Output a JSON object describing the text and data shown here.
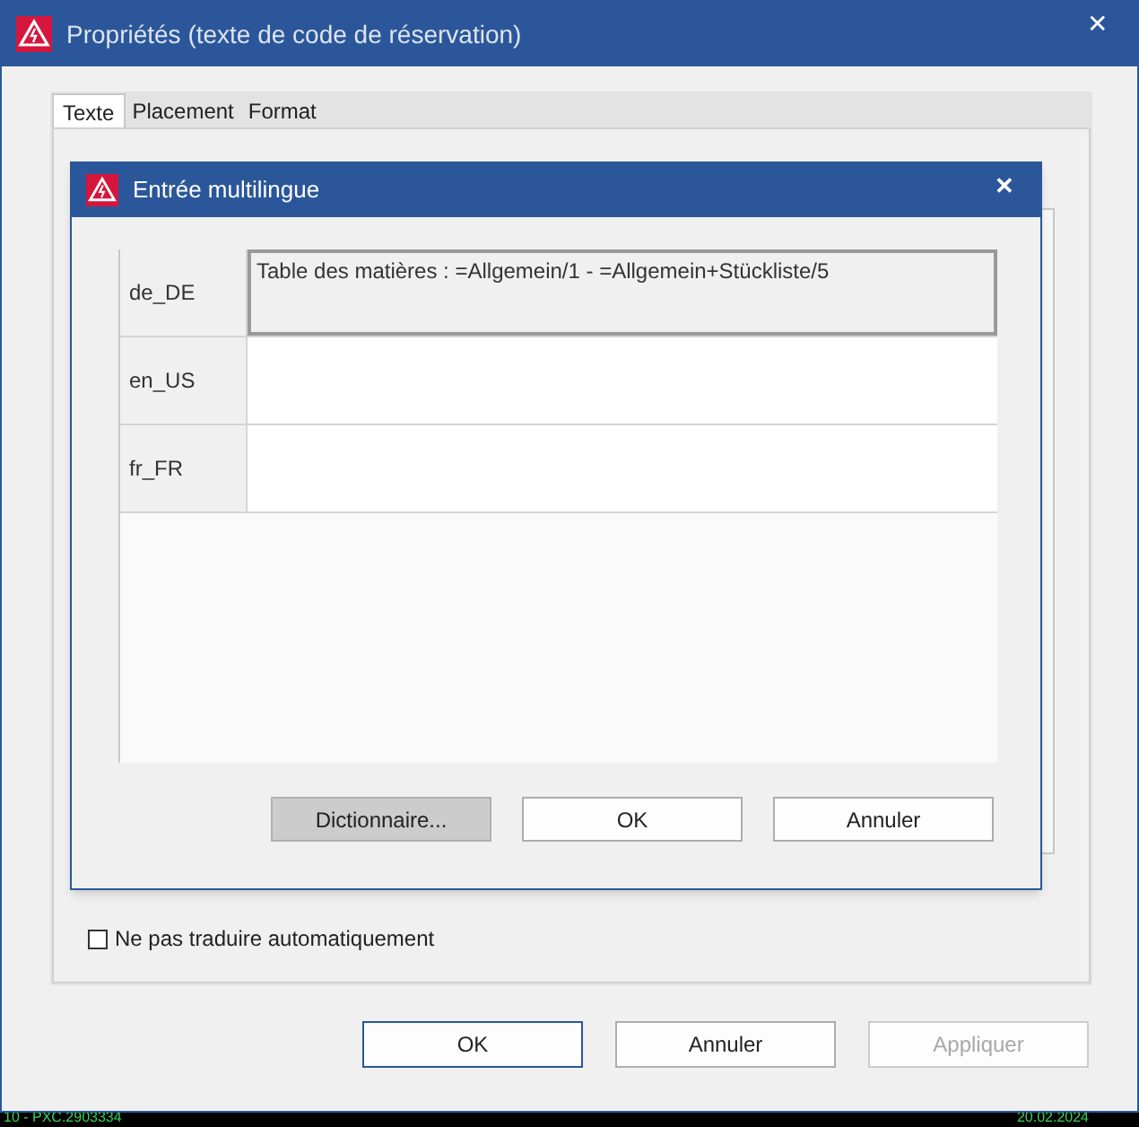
{
  "window": {
    "title": "Propriétés (texte de code de réservation)",
    "close": "✕"
  },
  "tabs": [
    {
      "label": "Texte",
      "selected": true
    },
    {
      "label": "Placement",
      "selected": false
    },
    {
      "label": "Format",
      "selected": false
    }
  ],
  "options": [
    {
      "label": "Ne pas traduire automatiquement",
      "checked": false,
      "disabled": false
    }
  ],
  "buttons": [
    {
      "label": "OK",
      "default": true,
      "disabled": false
    },
    {
      "label": "Annuler",
      "default": false,
      "disabled": false
    },
    {
      "label": "Appliquer",
      "default": false,
      "disabled": true
    }
  ],
  "dialog": {
    "title": "Entrée multilingue",
    "close": "✕",
    "rows": [
      {
        "language": "de_DE",
        "value": "Table des matières : =Allgemein/1 - =Allgemein+Stückliste/5",
        "selected": true
      },
      {
        "language": "en_US",
        "value": "",
        "selected": false
      },
      {
        "language": "fr_FR",
        "value": "",
        "selected": false
      }
    ],
    "buttons": [
      {
        "label": "Dictionnaire...",
        "pressed": true
      },
      {
        "label": "OK",
        "pressed": false
      },
      {
        "label": "Annuler",
        "pressed": false
      }
    ]
  },
  "background_status": [
    "10 - PXC.2903334",
    "20.02.2024"
  ]
}
